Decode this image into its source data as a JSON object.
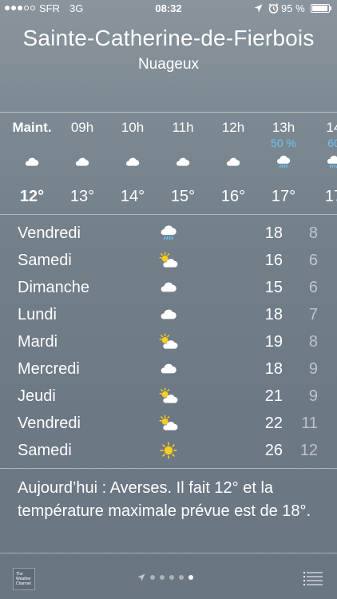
{
  "status_bar": {
    "carrier": "SFR",
    "network": "3G",
    "time": "08:32",
    "battery": "95 %",
    "battery_level": 0.95,
    "signal_bars": 3,
    "signal_max": 5
  },
  "header": {
    "city": "Sainte-Catherine-de-Fierbois",
    "condition": "Nuageux"
  },
  "hourly": [
    {
      "time": "Maint.",
      "precip": "",
      "icon": "cloud-icon",
      "temp": "12°",
      "now": true
    },
    {
      "time": "09h",
      "precip": "",
      "icon": "cloud-icon",
      "temp": "13°"
    },
    {
      "time": "10h",
      "precip": "",
      "icon": "cloud-icon",
      "temp": "14°"
    },
    {
      "time": "11h",
      "precip": "",
      "icon": "cloud-icon",
      "temp": "15°"
    },
    {
      "time": "12h",
      "precip": "",
      "icon": "cloud-icon",
      "temp": "16°"
    },
    {
      "time": "13h",
      "precip": "50 %",
      "icon": "rain-cloud-icon",
      "temp": "17°"
    },
    {
      "time": "14",
      "precip": "60",
      "icon": "rain-cloud-icon",
      "temp": "17"
    }
  ],
  "daily": [
    {
      "day": "Vendredi",
      "icon": "rain-cloud-icon",
      "high": "18",
      "low": "8"
    },
    {
      "day": "Samedi",
      "icon": "partly-sunny-icon",
      "high": "16",
      "low": "6"
    },
    {
      "day": "Dimanche",
      "icon": "cloud-icon",
      "high": "15",
      "low": "6"
    },
    {
      "day": "Lundi",
      "icon": "cloud-icon",
      "high": "18",
      "low": "7"
    },
    {
      "day": "Mardi",
      "icon": "partly-sunny-icon",
      "high": "19",
      "low": "8"
    },
    {
      "day": "Mercredi",
      "icon": "cloud-icon",
      "high": "18",
      "low": "9"
    },
    {
      "day": "Jeudi",
      "icon": "partly-sunny-icon",
      "high": "21",
      "low": "9"
    },
    {
      "day": "Vendredi",
      "icon": "partly-sunny-icon",
      "high": "22",
      "low": "11"
    },
    {
      "day": "Samedi",
      "icon": "sun-icon",
      "high": "26",
      "low": "12"
    }
  ],
  "summary": "Aujourd’hui : Averses. Il fait 12° et la température maximale prévue est de 18°.",
  "footer": {
    "logo_text": [
      "The",
      "Weather",
      "Channel"
    ],
    "page_count": 5,
    "active_page": 4,
    "location_icon": "location-arrow-icon",
    "list_icon": "list-icon"
  },
  "colors": {
    "precip": "#6cc3f6",
    "sun": "#f7cd1e",
    "low_temp": "rgba(255,255,255,0.55)"
  }
}
